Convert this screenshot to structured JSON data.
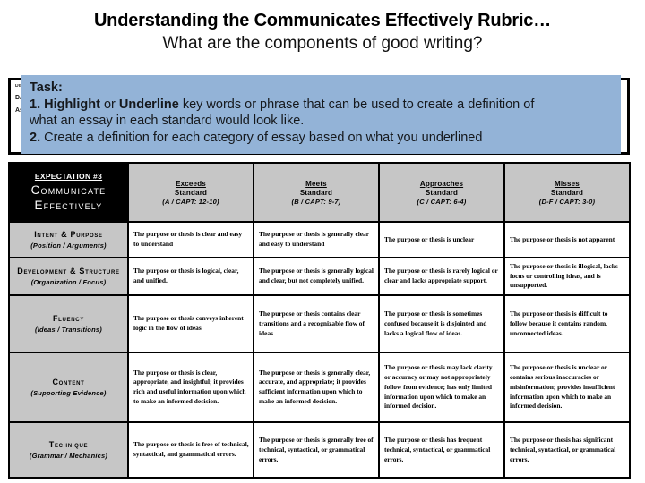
{
  "header": {
    "title": "Understanding the Communicates Effectively Rubric…",
    "subtitle": "What are the components of good writing?"
  },
  "behind_text": {
    "line1": "Disc",
    "line2": "DA",
    "line3": "As"
  },
  "task_box": {
    "bg_color": "#93b3d7",
    "heading": "Task:",
    "item1_num": "1.",
    "item1_bold_a": "Highlight",
    "item1_mid": "or",
    "item1_bold_b": "Underline",
    "item1_rest": "key words or phrase that can be used to create a definition of",
    "item1_line2": "what an essay in each standard would look like.",
    "item2_num": "2.",
    "item2_rest": "Create a definition for each category of essay based on what you underlined"
  },
  "rubric": {
    "corner": {
      "expectation": "Expectation #3",
      "name": "Communicate Effectively"
    },
    "bands": [
      {
        "name": "Exceeds",
        "standard": "Standard",
        "scale": "(A / CAPT: 12-10)"
      },
      {
        "name": "Meets",
        "standard": "Standard",
        "scale": "(B / CAPT: 9-7)"
      },
      {
        "name": "Approaches",
        "standard": "Standard",
        "scale": "(C / CAPT: 6-4)"
      },
      {
        "name": "Misses",
        "standard": "Standard",
        "scale": "(D-F / CAPT: 3-0)"
      }
    ],
    "rows": [
      {
        "label": "Intent & Purpose",
        "sublabel": "(Position / Arguments)",
        "cells": [
          "The purpose or thesis is clear and easy to understand",
          "The purpose or thesis is generally clear and easy to understand",
          "The purpose or thesis is unclear",
          "The purpose or thesis is not apparent"
        ]
      },
      {
        "label": "Development & Structure",
        "sublabel": "(Organization / Focus)",
        "cells": [
          "The purpose or thesis is logical, clear, and unified.",
          "The purpose or thesis is generally logical and clear, but not completely unified.",
          "The purpose or thesis is rarely logical or clear and lacks appropriate support.",
          "The purpose or thesis is illogical, lacks focus or controlling ideas, and is unsupported."
        ]
      },
      {
        "label": "Fluency",
        "sublabel": "(Ideas / Transitions)",
        "cells": [
          "The purpose or thesis conveys inherent logic in the flow of ideas",
          "The purpose or thesis contains clear transitions and a recognizable flow of ideas",
          "The purpose or thesis is sometimes confused because it is disjointed and lacks a logical flow of ideas.",
          "The purpose or thesis is difficult to follow because it contains random, unconnected ideas."
        ]
      },
      {
        "label": "Content",
        "sublabel": "(Supporting Evidence)",
        "cells": [
          "The purpose or thesis is clear, appropriate, and insightful; it provides rich and useful information upon which to make an informed decision.",
          "The purpose or thesis is generally clear, accurate, and appropriate; it provides sufficient information upon which to make an informed decision.",
          "The purpose or thesis may lack clarity or accuracy or may not appropriately follow from evidence; has only limited information upon which to make an informed decision.",
          "The purpose or thesis is unclear or contains serious inaccuracies or misinformation; provides insufficient information upon which to make an informed decision."
        ]
      },
      {
        "label": "Technique",
        "sublabel": "(Grammar / Mechanics)",
        "cells": [
          "The purpose or thesis is free of technical, syntactical, and grammatical errors.",
          "The purpose or thesis is generally free of technical, syntactical, or grammatical errors.",
          "The purpose or thesis has frequent technical, syntactical, or grammatical errors.",
          "The purpose or thesis has significant technical, syntactical, or grammatical errors."
        ]
      }
    ]
  }
}
